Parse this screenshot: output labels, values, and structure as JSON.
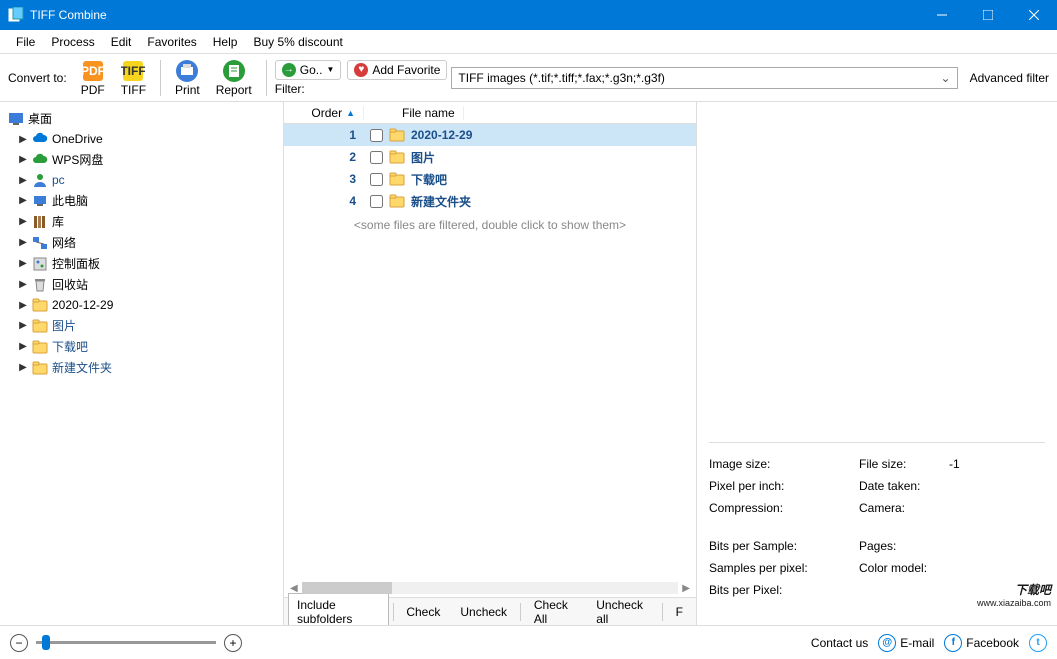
{
  "window": {
    "title": "TIFF Combine"
  },
  "menu": [
    "File",
    "Process",
    "Edit",
    "Favorites",
    "Help",
    "Buy 5% discount"
  ],
  "toolbar": {
    "convert_label": "Convert to:",
    "pdf": "PDF",
    "tiff": "TIFF",
    "print": "Print",
    "report": "Report",
    "go": "Go..",
    "add_fav": "Add Favorite",
    "filter_label": "Filter:",
    "filter_value": "TIFF images (*.tif;*.tiff;*.fax;*.g3n;*.g3f)",
    "advanced": "Advanced filter"
  },
  "tree": {
    "root": "桌面",
    "items": [
      {
        "label": "OneDrive",
        "icon": "cloud",
        "link": false
      },
      {
        "label": "WPS网盘",
        "icon": "cloud2",
        "link": false
      },
      {
        "label": "pc",
        "icon": "user",
        "link": true
      },
      {
        "label": "此电脑",
        "icon": "pc",
        "link": false
      },
      {
        "label": "库",
        "icon": "lib",
        "link": false
      },
      {
        "label": "网络",
        "icon": "net",
        "link": false
      },
      {
        "label": "控制面板",
        "icon": "cpanel",
        "link": false
      },
      {
        "label": "回收站",
        "icon": "bin",
        "link": false
      },
      {
        "label": "2020-12-29",
        "icon": "folder",
        "link": false
      },
      {
        "label": "图片",
        "icon": "folder",
        "link": true
      },
      {
        "label": "下载吧",
        "icon": "folder",
        "link": true
      },
      {
        "label": "新建文件夹",
        "icon": "folder",
        "link": true
      }
    ]
  },
  "list": {
    "col_order": "Order",
    "col_name": "File name",
    "rows": [
      {
        "order": "1",
        "name": "2020-12-29",
        "selected": true
      },
      {
        "order": "2",
        "name": "图片",
        "selected": false
      },
      {
        "order": "3",
        "name": "下载吧",
        "selected": false
      },
      {
        "order": "4",
        "name": "新建文件夹",
        "selected": false
      }
    ],
    "filtered_msg": "<some files are filtered, double click to show them>"
  },
  "btnbar": {
    "include": "Include subfolders",
    "check": "Check",
    "uncheck": "Uncheck",
    "check_all": "Check All",
    "uncheck_all": "Uncheck all",
    "f": "F"
  },
  "meta": {
    "image_size": "Image size:",
    "file_size": "File size:",
    "file_size_val": "-1",
    "ppi": "Pixel per inch:",
    "date_taken": "Date taken:",
    "compression": "Compression:",
    "camera": "Camera:",
    "bps": "Bits per Sample:",
    "pages": "Pages:",
    "spp": "Samples per pixel:",
    "color_model": "Color model:",
    "bpp": "Bits per Pixel:"
  },
  "footer": {
    "contact": "Contact us",
    "email": "E-mail",
    "facebook": "Facebook"
  },
  "watermark": {
    "main": "下载吧",
    "sub": "www.xiazaiba.com"
  }
}
